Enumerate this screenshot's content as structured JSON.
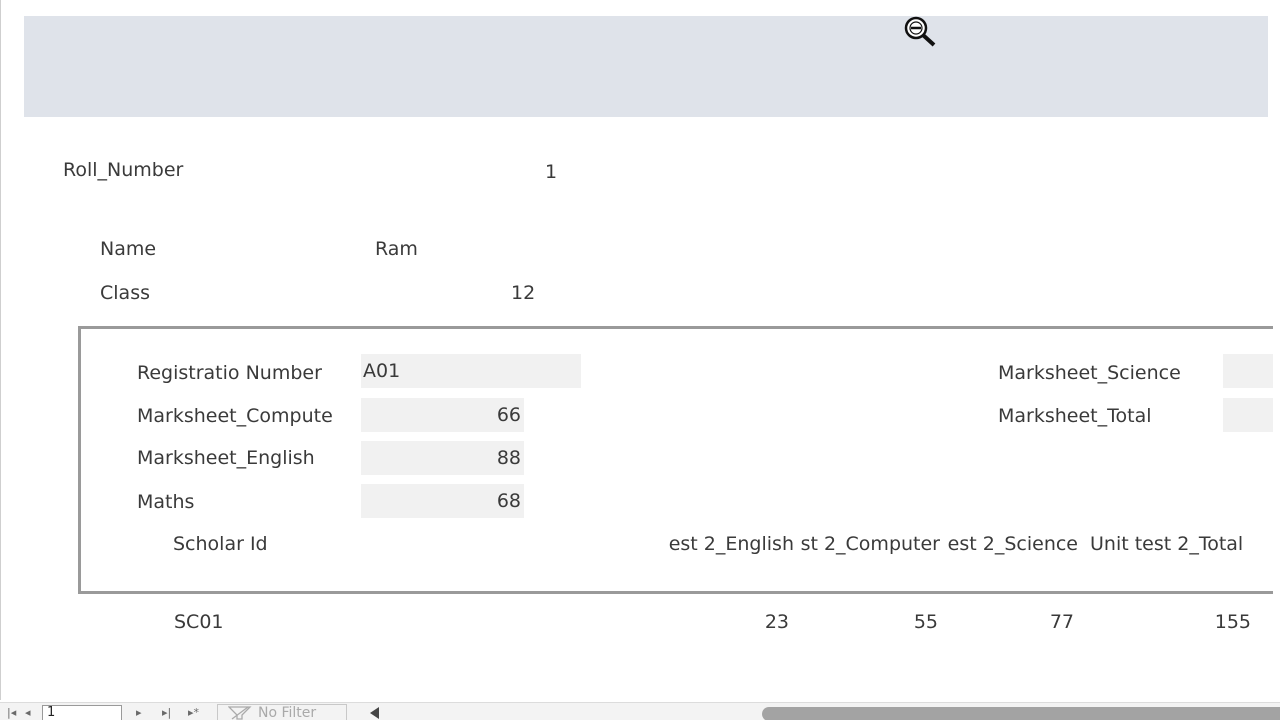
{
  "header": {
    "zoom_icon": "zoom-out-magnifier-icon"
  },
  "record": {
    "roll_number_label": "Roll_Number",
    "roll_number_value": "1",
    "name_label": "Name",
    "name_value": "Ram",
    "class_label": "Class",
    "class_value": "12"
  },
  "subform": {
    "registration_label": "Registratio Number",
    "registration_value": "A01",
    "computer_label": "Marksheet_Compute",
    "computer_value": "66",
    "english_label": "Marksheet_English",
    "english_value": "88",
    "maths_label": "Maths",
    "maths_value": "68",
    "science_label": "Marksheet_Science",
    "science_value": "",
    "total_label": "Marksheet_Total",
    "total_value": "",
    "columns": {
      "scholar_id": "Scholar Id",
      "unit2_english": "est 2_English",
      "unit2_computer": "st 2_Computer",
      "unit2_science": "est 2_Science",
      "unit2_total": "Unit test 2_Total"
    }
  },
  "scholar_row": {
    "scholar_id": "SC01",
    "english": "23",
    "computer": "55",
    "science": "77",
    "total": "155"
  },
  "navigation": {
    "record_value": "1",
    "filter_label": "No Filter"
  }
}
